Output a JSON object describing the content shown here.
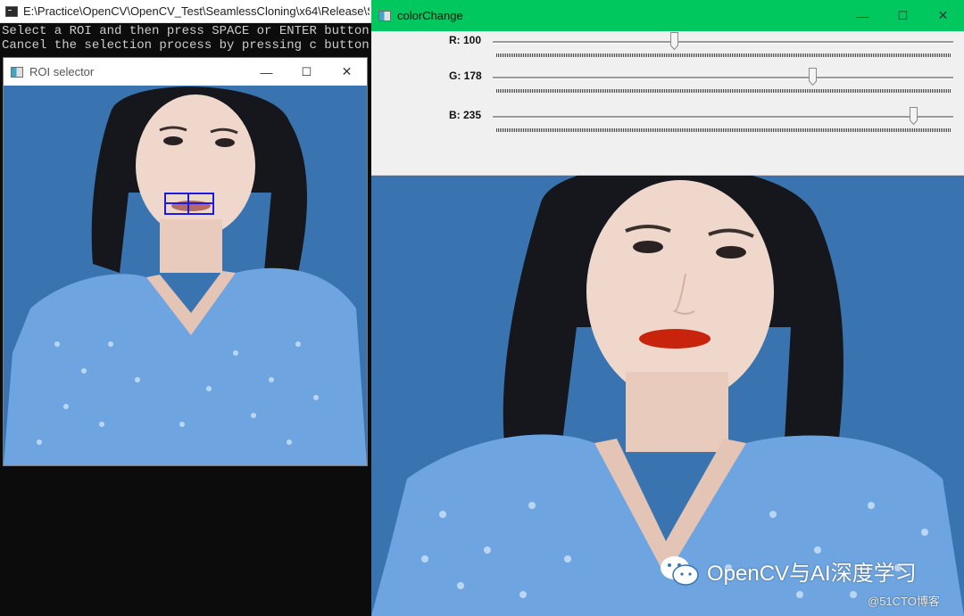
{
  "console": {
    "title": "E:\\Practice\\OpenCV\\OpenCV_Test\\SeamlessCloning\\x64\\Release\\Se",
    "lines": [
      "Select a ROI and then press SPACE or ENTER button!",
      "Cancel the selection process by pressing c button!"
    ]
  },
  "roi_window": {
    "title": "ROI selector",
    "controls": {
      "minimize": "—",
      "maximize": "☐",
      "close": "✕"
    }
  },
  "color_change_window": {
    "title": "colorChange",
    "controls": {
      "minimize": "—",
      "maximize": "☐",
      "close": "✕"
    },
    "trackbars": [
      {
        "label": "R: 100",
        "value": 100,
        "max": 255
      },
      {
        "label": "G: 178",
        "value": 178,
        "max": 255
      },
      {
        "label": "B: 235",
        "value": 235,
        "max": 255
      }
    ]
  },
  "watermark": {
    "brand": "OpenCV与AI深度学习",
    "source": "@51CTO博客"
  },
  "colors": {
    "titlebar_active": "#00c85e",
    "roi_rectangle": "#1d19e0",
    "photo_background": "#3a74b0",
    "dress": "#6ea5e0",
    "lip_color": "#c8240d"
  }
}
